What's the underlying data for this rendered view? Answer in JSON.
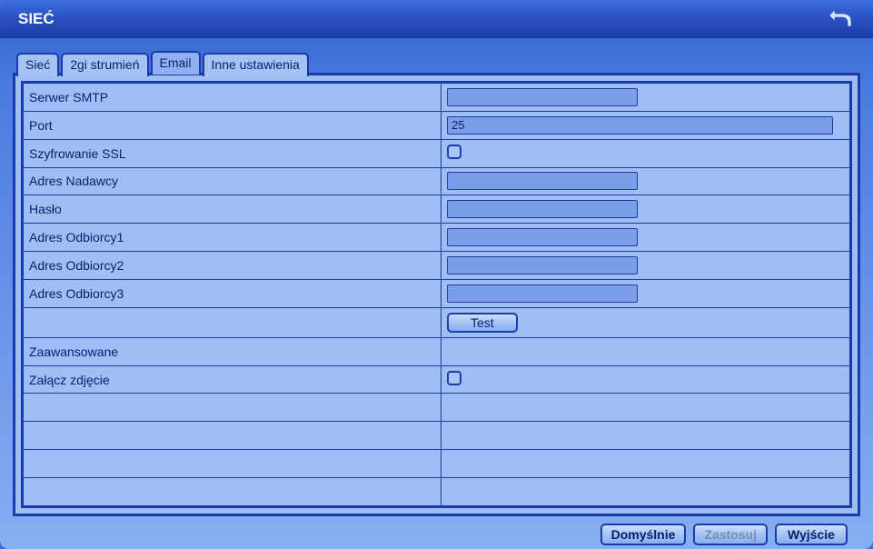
{
  "window": {
    "title": "SIEĆ"
  },
  "tabs": {
    "items": [
      {
        "label": "Sieć"
      },
      {
        "label": "2gi strumień"
      },
      {
        "label": "Email"
      },
      {
        "label": "Inne ustawienia"
      }
    ],
    "activeIndex": 2
  },
  "form": {
    "smtp_server_label": "Serwer SMTP",
    "smtp_server_value": "",
    "port_label": "Port",
    "port_value": "25",
    "ssl_label": "Szyfrowanie SSL",
    "ssl_checked": false,
    "sender_label": "Adres Nadawcy",
    "sender_value": "",
    "password_label": "Hasło",
    "password_value": "",
    "recipient1_label": "Adres Odbiorcy1",
    "recipient1_value": "",
    "recipient2_label": "Adres Odbiorcy2",
    "recipient2_value": "",
    "recipient3_label": "Adres Odbiorcy3",
    "recipient3_value": "",
    "test_button": "Test",
    "advanced_label": "Zaawansowane",
    "attach_image_label": "Załącz zdjęcie",
    "attach_image_checked": false
  },
  "footer": {
    "default_button": "Domyślnie",
    "apply_button": "Zastosuj",
    "exit_button": "Wyjście"
  }
}
